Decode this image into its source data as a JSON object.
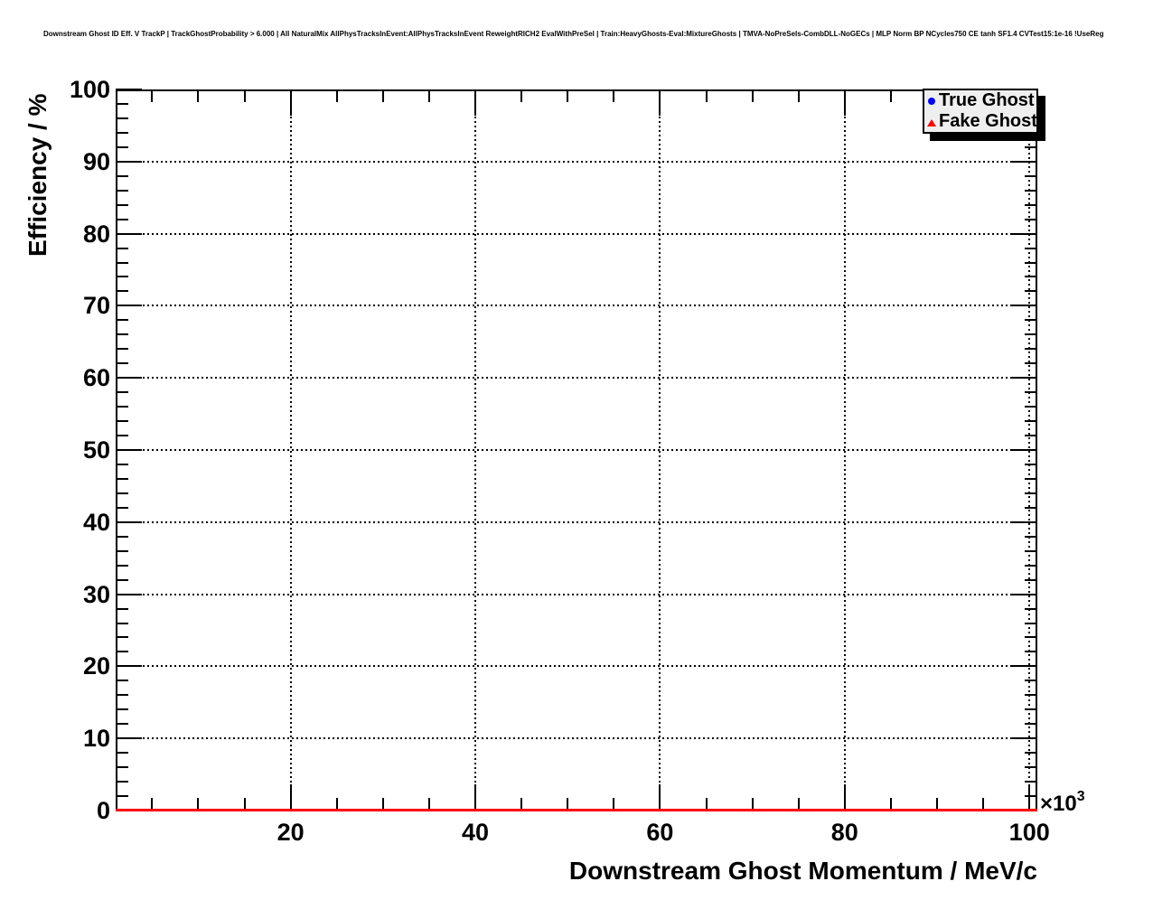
{
  "header": {
    "title": "Downstream Ghost ID Eff. V TrackP | TrackGhostProbability > 6.000 | All NaturalMix AllPhysTracksInEvent:AllPhysTracksInEvent ReweightRICH2 EvalWithPreSel | Train:HeavyGhosts-Eval:MixtureGhosts | TMVA-NoPreSels-CombDLL-NoGECs | MLP Norm BP NCycles750 CE tanh SF1.4 CVTest15:1e-16 !UseReg"
  },
  "axes": {
    "x": {
      "multiplier_base": "×10",
      "multiplier_exp": "3"
    }
  },
  "legend": {
    "position": "top-right",
    "entries": [
      {
        "label": "True Ghost",
        "marker": "circle",
        "color": "#0000ff"
      },
      {
        "label": "Fake Ghost",
        "marker": "triangle",
        "color": "#ff0000"
      }
    ]
  },
  "chart_data": {
    "type": "line",
    "title": "Downstream Ghost ID Eff. V TrackP | TrackGhostProbability > 6.000 | All NaturalMix AllPhysTracksInEvent:AllPhysTracksInEvent ReweightRICH2 EvalWithPreSel | Train:HeavyGhosts-Eval:MixtureGhosts | TMVA-NoPreSels-CombDLL-NoGECs | MLP Norm BP NCycles750 CE tanh SF1.4 CVTest15:1e-16 !UseReg",
    "xlabel": "Downstream Ghost Momentum / MeV/c",
    "ylabel": "Efficiency / %",
    "x_unit_multiplier": "×10^3",
    "xlim": [
      1.05,
      100.86
    ],
    "ylim": [
      0,
      100
    ],
    "x_major_ticks": [
      20,
      40,
      60,
      80,
      100
    ],
    "x_minor_tick_step": 5,
    "y_major_ticks": [
      0,
      10,
      20,
      30,
      40,
      50,
      60,
      70,
      80,
      90,
      100
    ],
    "y_minor_tick_step": 2,
    "grid": "dotted gridlines at major ticks, both axes",
    "legend_position": "top-right",
    "frame_color": "#000000",
    "series": [
      {
        "name": "True Ghost",
        "marker": "circle",
        "color": "#0000ff",
        "x": [],
        "y": [],
        "note": "no data points visible in plot area"
      },
      {
        "name": "Fake Ghost",
        "marker": "triangle",
        "color": "#ff0000",
        "x": [
          1.05,
          100.86
        ],
        "y": [
          0,
          0
        ],
        "note": "flat red line at efficiency 0 along entire x-axis"
      }
    ]
  }
}
